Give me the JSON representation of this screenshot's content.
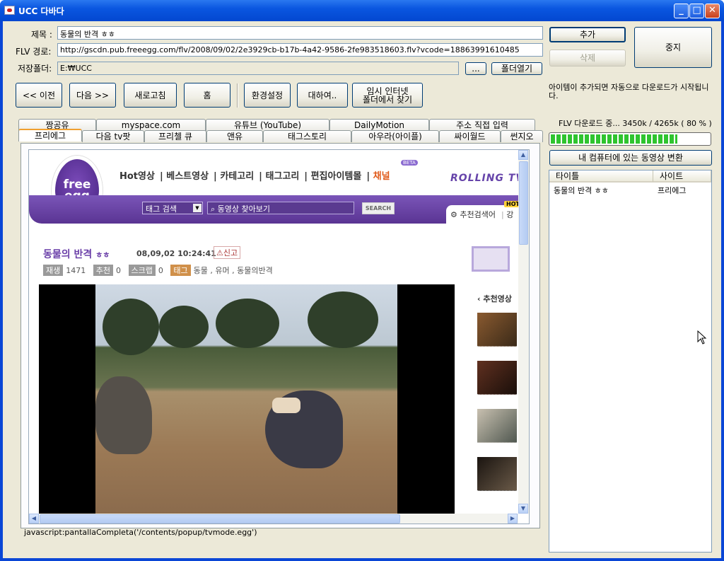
{
  "window": {
    "title": "UCC 다바다"
  },
  "form": {
    "title_label": "제목 :",
    "title_value": "동물의 반격 ㅎㅎ",
    "flv_label": "FLV 경로:",
    "flv_value": "http://gscdn.pub.freeegg.com/flv/2008/09/02/2e3929cb-b17b-4a42-9586-2fe983518603.flv?vcode=18863991610485",
    "folder_label": "저장폴더:",
    "folder_value": "E:₩UCC",
    "browse_label": "...",
    "open_folder_label": "폴더열기"
  },
  "buttons": {
    "add": "추가",
    "delete": "삭제",
    "stop": "중지",
    "prev": "<< 이전",
    "next": "다음 >>",
    "refresh": "새로고침",
    "home": "홈",
    "settings": "환경설정",
    "about": "대하여..",
    "temp_line1": "임시 인터넷",
    "temp_line2": "폴더에서 찾기",
    "convert": "내 컴퓨터에 있는 동영상 변환"
  },
  "tabs_back": [
    "짱공유",
    "myspace.com",
    "유튜브 (YouTube)",
    "DailyMotion",
    "주소 직접 입력"
  ],
  "tabs_front": [
    "프리에그",
    "다음 tv팟",
    "프리첼 큐",
    "앤유",
    "태그스토리",
    "아우라(아이플)",
    "싸이월드",
    "썬지오"
  ],
  "info_text": "아이템이 추가되면 자동으로 다운로드가 시작됩니다.",
  "download": {
    "status": "FLV 다운로드 중... 3450k / 4265k ( 80 % )",
    "progress": 0.8
  },
  "list": {
    "columns": [
      "타이틀",
      "사이트"
    ],
    "rows": [
      {
        "title": "동물의 반격 ㅎㅎ",
        "site": "프리에그"
      }
    ]
  },
  "status_url": "javascript:pantallaCompleta('/contents/popup/tvmode.egg')",
  "page": {
    "logo_line1": "free",
    "logo_line2": "egg",
    "nav": [
      "Hot영상",
      "베스트영상",
      "카테고리",
      "태그고리",
      "편집아이템몰",
      "채널"
    ],
    "beta": "BETA",
    "search_select": "태그 검색",
    "search_placeholder": "동영상 찾아보기",
    "search_button": "SEARCH",
    "rolling": "ROLLING TV",
    "hot_badge": "HOT",
    "rec_search": "추천검색어",
    "rec_more": "강",
    "video_title": "동물의 반격",
    "video_title_suffix": "ㅎㅎ",
    "date": "08,09,02  10:24:41",
    "report": "신고",
    "play_label": "재생",
    "play_count": "1471",
    "rec_label": "추천",
    "rec_count": "0",
    "scrap_label": "스크랩",
    "scrap_count": "0",
    "tag_label": "태그",
    "tags": "동물 , 유머 , 동물의반격",
    "related": "추천영상"
  }
}
